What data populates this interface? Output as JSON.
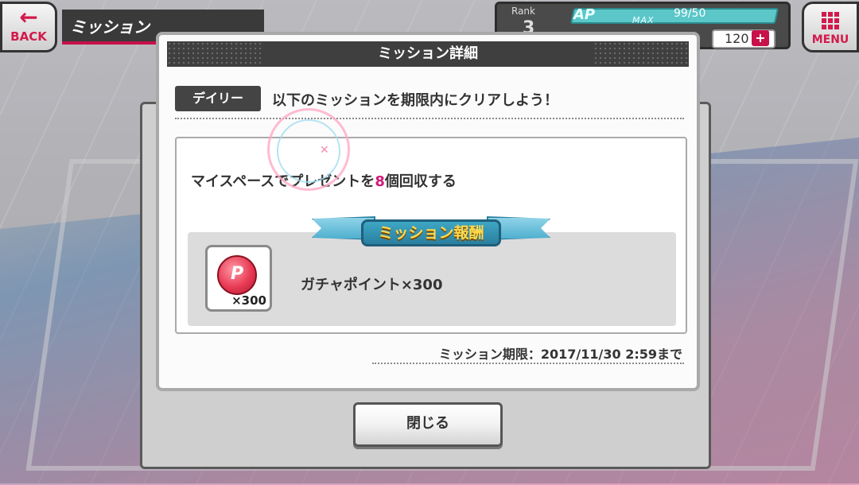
{
  "header": {
    "back_label": "BACK",
    "screen_title": "ミッション",
    "rank_label": "Rank",
    "rank_value": "3",
    "ap_label": "AP",
    "ap_max_label": "MAX",
    "ap_value": "99/50",
    "coin_value": "120",
    "coin_plus": "+",
    "menu_label": "MENU"
  },
  "modal": {
    "title": "ミッション詳細",
    "category_badge": "デイリー",
    "intro_text": "以下のミッションを期限内にクリアしよう！",
    "mission_prefix": "マイスペースでプレゼントを",
    "mission_count": "8",
    "mission_suffix": "個回収する",
    "reward_ribbon": "ミッション報酬",
    "reward_icon_letter": "P",
    "reward_icon_qty": "×300",
    "reward_name": "ガチャポイント×300",
    "deadline": "ミッション期限：2017/11/30 2:59まで",
    "close_label": "閉じる"
  },
  "icons": {
    "back": "arrow-left-icon",
    "menu": "grid-icon",
    "reward": "gacha-point-coin-icon"
  },
  "colors": {
    "accent": "#d21a4c",
    "highlight": "#d21a78",
    "header_bg": "#3f3f3f",
    "ribbon": "#2a7fa0",
    "ap_bar": "#5bc7c9"
  }
}
